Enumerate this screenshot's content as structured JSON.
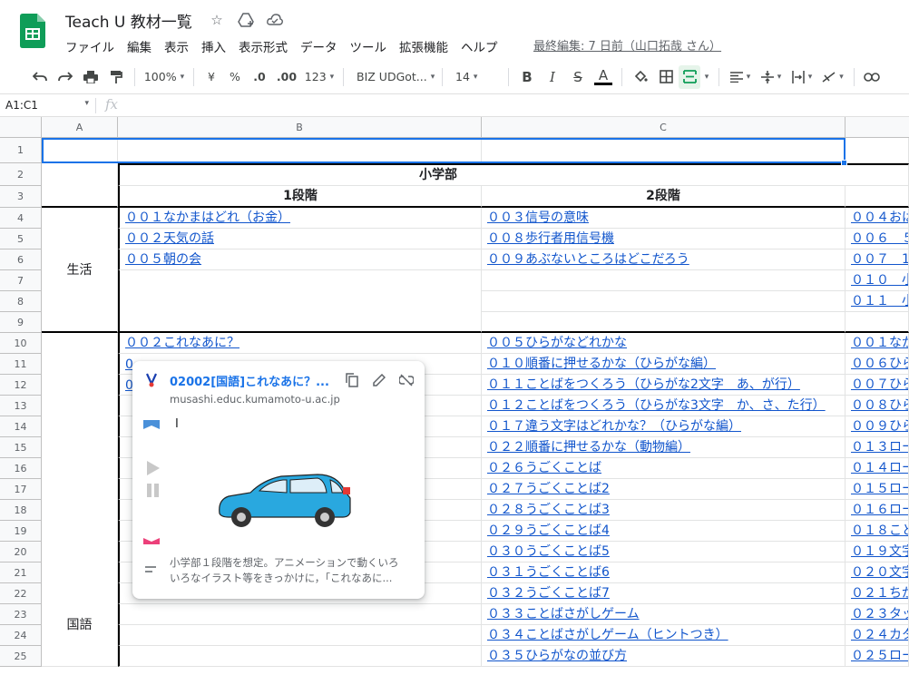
{
  "doc": {
    "title": "Teach U 教材一覧",
    "menu": [
      "ファイル",
      "編集",
      "表示",
      "挿入",
      "表示形式",
      "データ",
      "ツール",
      "拡張機能",
      "ヘルプ"
    ],
    "last_edit": "最終編集: 7 日前（山口拓哉 さん）"
  },
  "toolbar": {
    "zoom": "100%",
    "currency": "¥",
    "percent": "%",
    "dec_less": ".0",
    "dec_more": ".00",
    "format_more": "123",
    "font": "BIZ UDGot...",
    "font_size": "14"
  },
  "formula": {
    "namebox": "A1:C1",
    "fx": "fx"
  },
  "grid": {
    "columns": [
      "A",
      "B",
      "C"
    ],
    "rows": [
      "1",
      "2",
      "3",
      "4",
      "5",
      "6",
      "7",
      "8",
      "9",
      "10",
      "11",
      "12",
      "13",
      "14",
      "15",
      "16",
      "17",
      "18",
      "19",
      "20",
      "21",
      "22",
      "23",
      "24",
      "25"
    ],
    "header_elementary": "小学部",
    "header_stage1": "1段階",
    "header_stage2": "2段階",
    "cat_life": "生活",
    "cat_japanese": "国語",
    "colB": {
      "r4": "００１なかまはどれ（お金）",
      "r5": "００２天気の話",
      "r6": "００５朝の会",
      "r10": "００２これなあに？",
      "r11": "0",
      "r12": "0"
    },
    "colC": {
      "r4": "００３信号の意味",
      "r5": "００８歩行者用信号機",
      "r6": "００９あぶないところはどこだろう",
      "r10": "００５ひらがなどれかな",
      "r11": "０１０順番に押せるかな（ひらがな編）",
      "r12": "０１１ことばをつくろう（ひらがな2文字　あ、が行）",
      "r13": "０１２ことばをつくろう（ひらがな3文字　か、さ、た行）",
      "r14": "０１７違う文字はどれかな？（ひらがな編）",
      "r15": "０２２順番に押せるかな（動物編）",
      "r16": "０２６うごくことば",
      "r17": "０２７うごくことば2",
      "r18": "０２８うごくことば3",
      "r19": "０２９うごくことば4",
      "r20": "０３０うごくことば5",
      "r21": "０３１うごくことば6",
      "r22": "０３２うごくことば7",
      "r23": "０３３ことばさがしゲーム",
      "r24": "０３４ことばさがしゲーム（ヒントつき）",
      "r25": "０３５ひらがなの並び方"
    },
    "colD": {
      "r4": "００４おは",
      "r5": "００６　５",
      "r6": "００７　1",
      "r7": "０１０　小",
      "r8": "０１１　小",
      "r10": "００１なか",
      "r11": "００６ひら",
      "r12": "００７ひら",
      "r13": "００８ひら",
      "r14": "００９ひら",
      "r15": "０１３ロー",
      "r16": "０１４ロー",
      "r17": "０１５ロー",
      "r18": "０１６ロー",
      "r19": "０１８こと",
      "r20": "０１９文字",
      "r21": "０２０文字",
      "r22": "０２１ちが",
      "r23": "０２３タッ",
      "r24": "０２４カタ",
      "r25": "０２５ロー"
    }
  },
  "popup": {
    "title": "02002[国語]これなあに？...",
    "domain": "musashi.educ.kumamoto-u.ac.jp",
    "cursor_text": "I",
    "desc_line1": "小学部１段階を想定。アニメーションで動くいろ",
    "desc_line2": "いろなイラスト等をきっかけに，「これなあに..."
  },
  "colors": {
    "link": "#1155cc",
    "accent": "#1a73e8",
    "sheets_green": "#0f9d58"
  }
}
